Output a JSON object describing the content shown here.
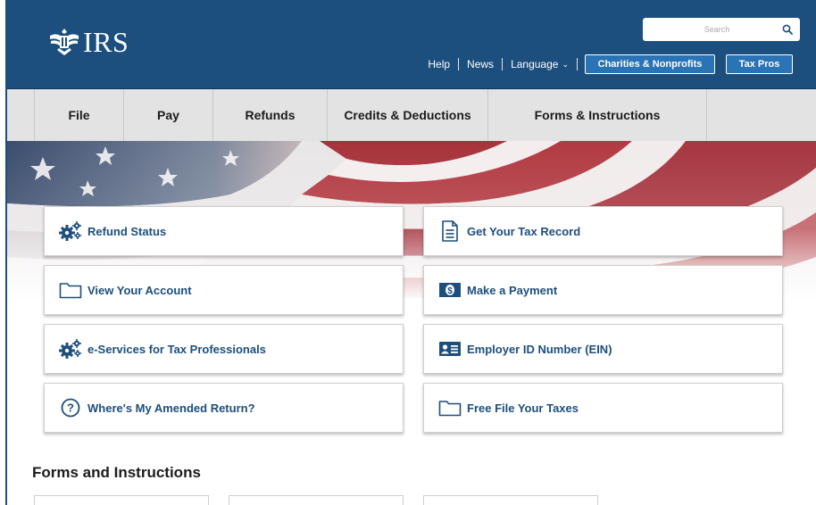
{
  "header": {
    "logo_text": "IRS",
    "search_placeholder": "Search",
    "utility_links": [
      "Help",
      "News",
      "Language"
    ],
    "buttons": [
      "Charities & Nonprofits",
      "Tax Pros"
    ]
  },
  "nav": {
    "items": [
      "File",
      "Pay",
      "Refunds",
      "Credits & Deductions",
      "Forms & Instructions"
    ]
  },
  "tiles": [
    {
      "label": "Refund Status",
      "icon": "gears-icon"
    },
    {
      "label": "Get Your Tax Record",
      "icon": "document-icon"
    },
    {
      "label": "View Your Account",
      "icon": "folder-icon"
    },
    {
      "label": "Make a Payment",
      "icon": "money-icon"
    },
    {
      "label": "e-Services for Tax Professionals",
      "icon": "gears-icon"
    },
    {
      "label": "Employer ID Number (EIN)",
      "icon": "id-card-icon"
    },
    {
      "label": "Where's My Amended Return?",
      "icon": "question-circle-icon"
    },
    {
      "label": "Free File Your Taxes",
      "icon": "folder-icon"
    }
  ],
  "forms_section": {
    "title": "Forms and Instructions"
  },
  "colors": {
    "header_blue": "#1c4e7e",
    "button_blue": "#2a73b4",
    "nav_gray": "#e3e3e3",
    "link_blue": "#1c4e7e"
  }
}
